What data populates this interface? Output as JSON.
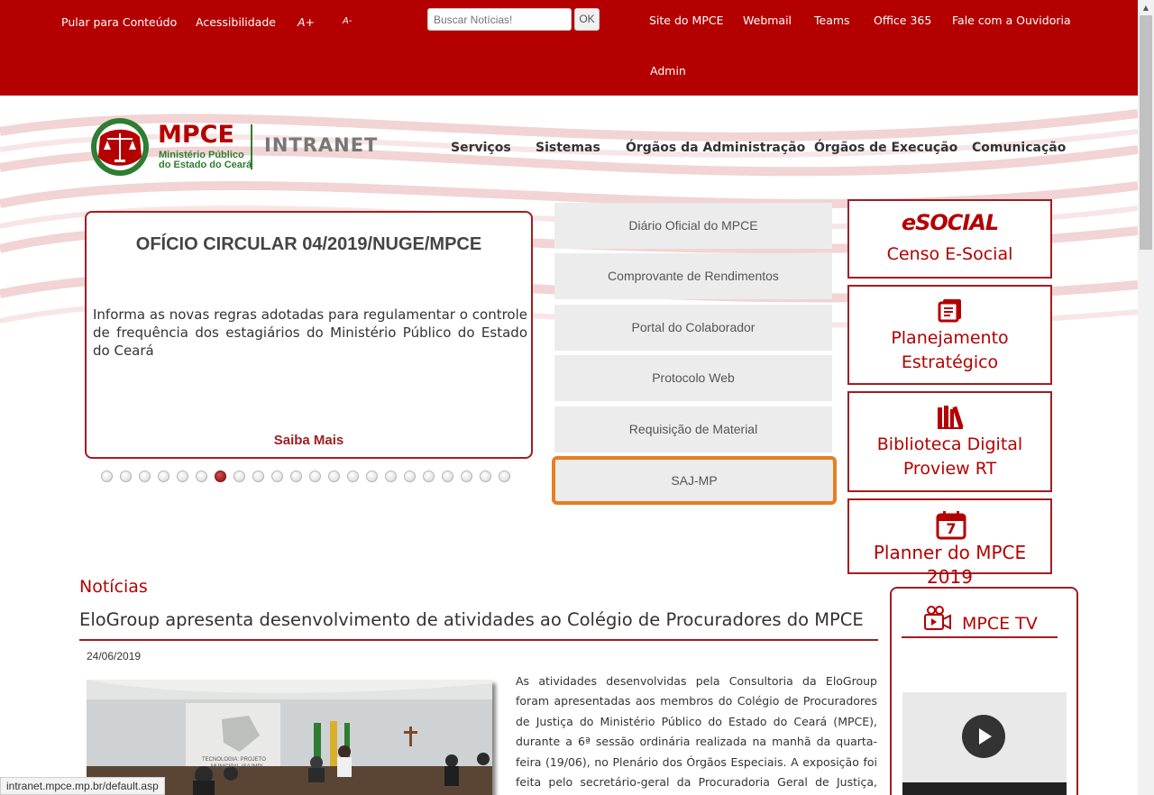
{
  "topbar": {
    "skip_link": "Pular para Conteúdo",
    "accessibility": "Acessibilidade",
    "font_increase": "A+",
    "font_decrease": "A-",
    "search_placeholder": "Buscar Notícias!",
    "search_button": "OK",
    "links": [
      "Site do MPCE",
      "Webmail",
      "Teams",
      "Office 365",
      "Fale com a Ouvidoria",
      "Admin"
    ]
  },
  "logo": {
    "acronym": "MPCE",
    "line1": "Ministério Público",
    "line2": "do Estado do Ceará",
    "intranet": "INTRANET"
  },
  "nav": [
    "Serviços",
    "Sistemas",
    "Órgãos da Administração",
    "Órgãos de Execução",
    "Comunicação"
  ],
  "slider": {
    "title": "OFÍCIO CIRCULAR 04/2019/NUGE/MPCE",
    "body": "Informa as novas regras adotadas para regulamentar o controle de frequência dos estagiários do Ministério Público do Estado do Ceará",
    "more": "Saiba Mais",
    "dot_count": 22,
    "active_dot": 6
  },
  "quick_links": [
    "Diário Oficial do MPCE",
    "Comprovante de Rendimentos",
    "Portal do Colaborador",
    "Protocolo Web",
    "Requisição de Material",
    "SAJ-MP"
  ],
  "features": {
    "esocial_logo": "eSOCIAL",
    "censo": "Censo E-Social",
    "planejamento_1": "Planejamento",
    "planejamento_2": "Estratégico",
    "biblioteca_1": "Biblioteca Digital",
    "biblioteca_2": "Proview RT",
    "planner_day": "7",
    "planner": "Planner do MPCE 2019"
  },
  "news": {
    "section": "Notícias",
    "title": "EloGroup apresenta desenvolvimento de atividades ao Colégio de Procuradores do MPCE",
    "date": "24/06/2019",
    "photo_caption": "TECNOLOGIA: PROJETO",
    "photo_caption2": "MUNICIPAL (SAJMP)",
    "text": "As atividades desenvolvidas pela Consultoria da EloGroup foram apresentadas aos membros do Colégio de Procuradores de Justiça do Ministério Público do Estado do Ceará (MPCE), durante a 6ª sessão ordinária realizada na manhã da quarta-feira (19/06), no Plenário dos Órgãos Especiais. A exposição foi feita pelo secretário-geral da Procuradoria Geral de Justiça, promotor de"
  },
  "tv": {
    "title": "MPCE TV"
  },
  "statusbar": "intranet.mpce.mp.br/default.asp",
  "colors": {
    "brand_red": "#b40000",
    "border_red": "#a01e22",
    "brand_green": "#2e7d32",
    "focus_orange": "#e67e22"
  },
  "icons": [
    "scales-icon",
    "document-list-icon",
    "books-icon",
    "calendar-icon",
    "video-camera-icon",
    "play-icon"
  ]
}
